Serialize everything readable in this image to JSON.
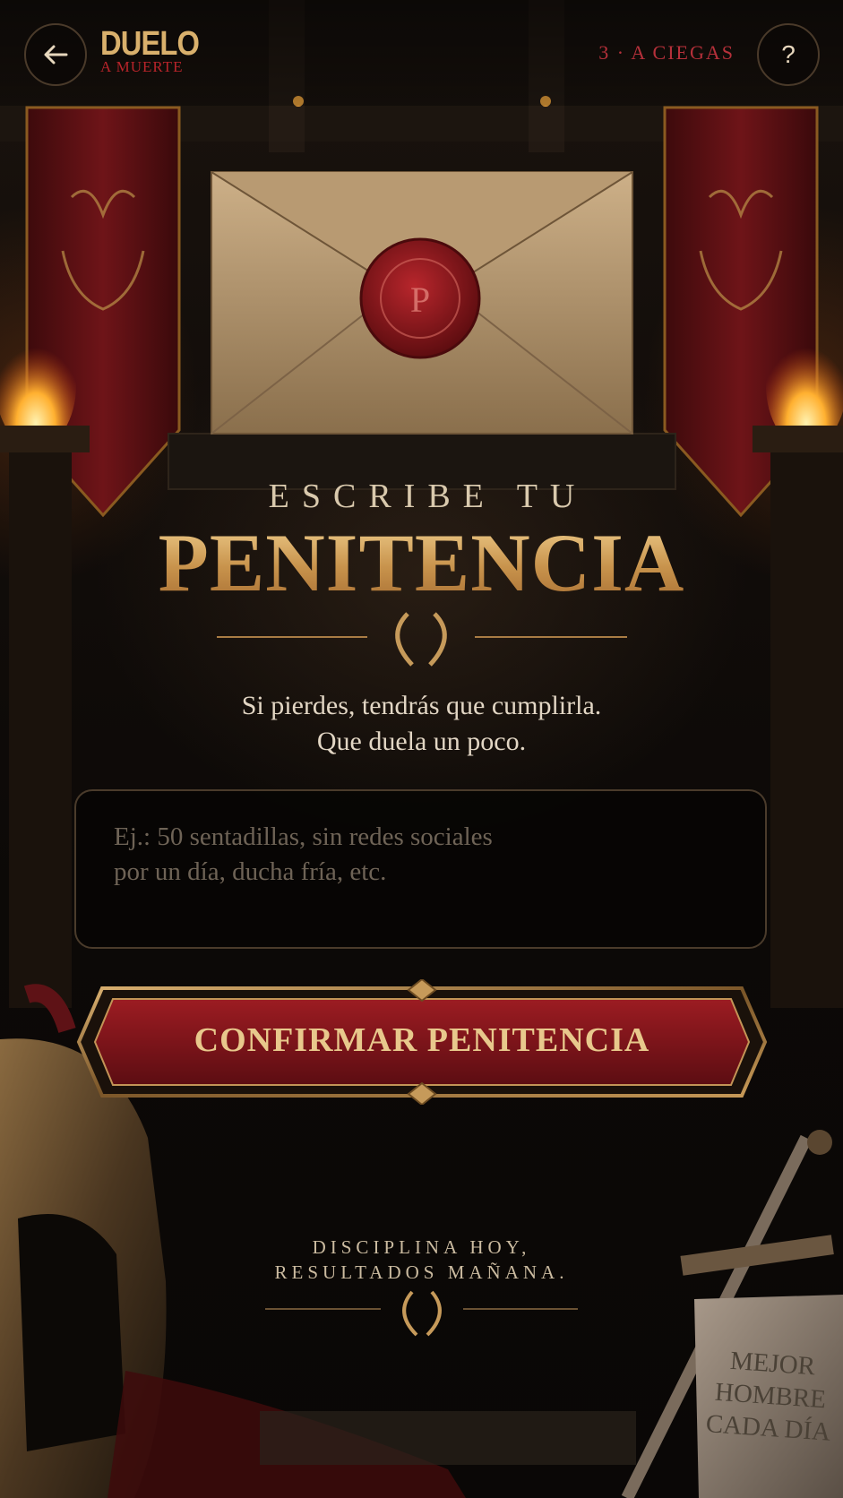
{
  "header": {
    "back_icon": "arrow-left-icon",
    "logo_main": "DUELO",
    "logo_sub": "A MUERTE",
    "mode_label": "3 · A CIEGAS",
    "help_label": "?"
  },
  "envelope": {
    "seal_letter": "P"
  },
  "heading": {
    "pre_title": "ESCRIBE TU",
    "title": "PENITENCIA"
  },
  "subtitle": {
    "line1": "Si pierdes, tendrás que cumplirla.",
    "line2": "Que duela un poco."
  },
  "penance_input": {
    "value": "",
    "placeholder": "Ej.: 50 sentadillas, sin redes sociales\npor un día, ducha fría, etc."
  },
  "confirm_button": {
    "label": "CONFIRMAR PENITENCIA"
  },
  "motto": {
    "line1": "DISCIPLINA HOY,",
    "line2": "RESULTADOS MAÑANA."
  },
  "stone_sign": {
    "line1": "MEJOR",
    "line2": "HOMBRE",
    "line3": "CADA DÍA"
  },
  "colors": {
    "gold": "#d6a45e",
    "crimson": "#8e1820",
    "mode_red": "#b5303a",
    "background": "#0b0806"
  }
}
